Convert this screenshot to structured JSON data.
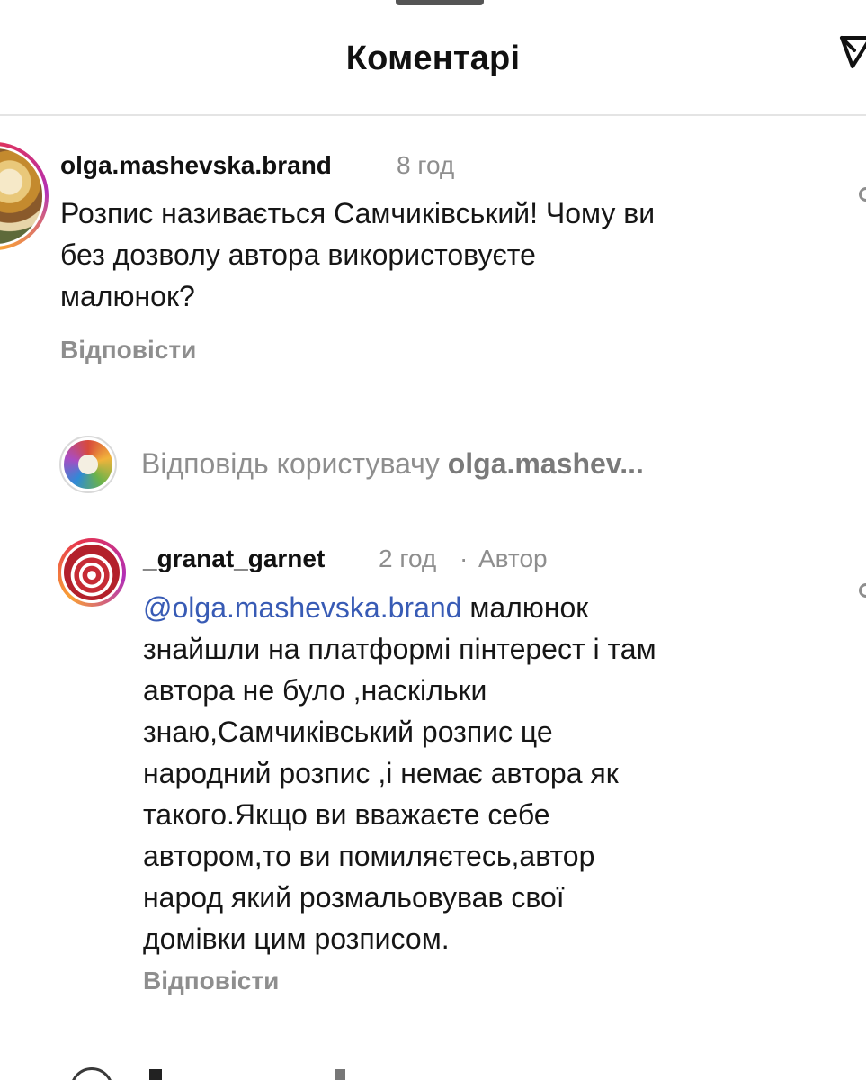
{
  "header": {
    "title": "Коментарі"
  },
  "comments": [
    {
      "username": "olga.mashevska.brand",
      "time": "8 год",
      "text_lines": [
        "Розпис називається Самчиківський! Чому ви",
        "без дозволу автора використовуєте",
        "малюнок?"
      ],
      "reply_label": "Відповісти"
    }
  ],
  "reply_summary": {
    "prefix": "Відповідь користувачу ",
    "user": "olga.mashev..."
  },
  "reply": {
    "username": "_granat_garnet",
    "time": "2 год",
    "separator": "·",
    "author_label": "Автор",
    "mention": "@olga.mashevska.brand",
    "text_lines": [
      " малюнок",
      "знайшли на платформі пінтерест і там",
      "автора не було ,наскільки",
      "знаю,Самчиківський розпис це",
      "народний розпис ,і немає автора як",
      "такого.Якщо ви вважаєте себе",
      "автором,то ви помиляєтесь,автор",
      "народ який розмальовував свої",
      "домівки цим розписом."
    ],
    "reply_label": "Відповісти"
  },
  "icons": {
    "share": "send-icon",
    "like": "heart-icon"
  },
  "colors": {
    "mention": "#385bb5",
    "secondary_text": "#8e8e8e"
  }
}
